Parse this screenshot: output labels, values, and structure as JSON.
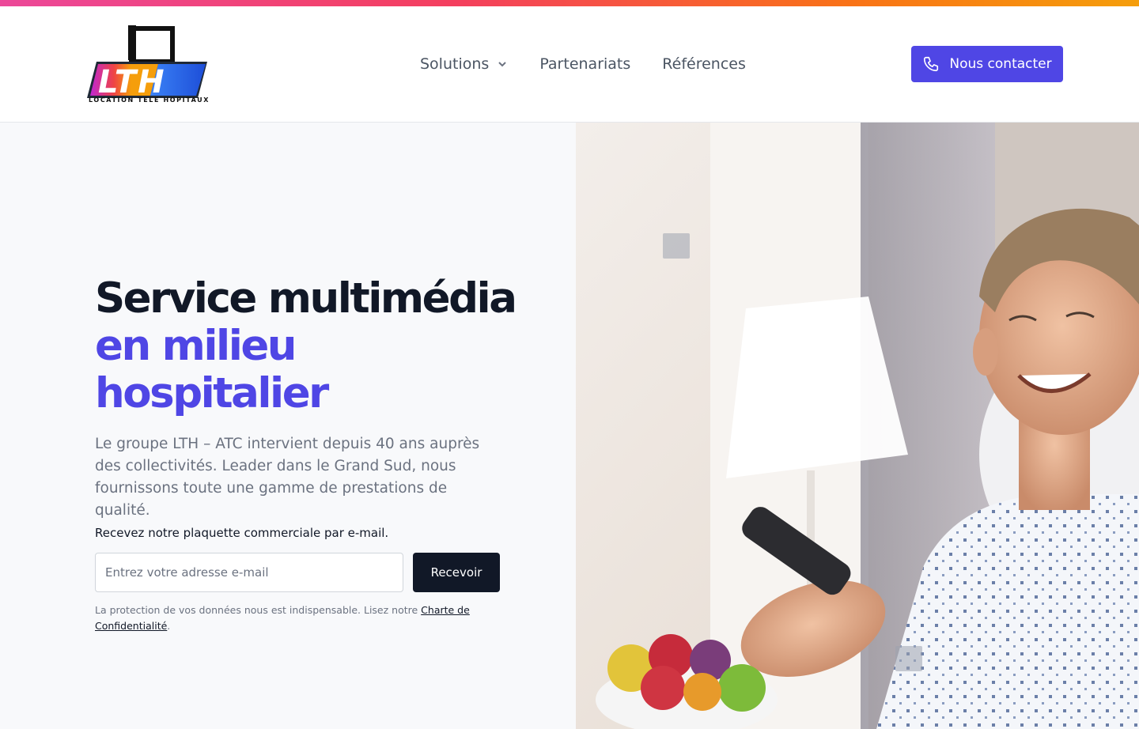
{
  "brand": {
    "logo_text": "LTH",
    "logo_tagline": "LOCATION TELE HOPITAUX",
    "colors": {
      "accent": "#4f46e5",
      "dark": "#111827",
      "gray": "#6b7280"
    }
  },
  "nav": {
    "items": [
      {
        "label": "Solutions",
        "has_dropdown": true
      },
      {
        "label": "Partenariats"
      },
      {
        "label": "Références"
      }
    ],
    "contact_label": "Nous contacter",
    "contact_icon": "phone-icon"
  },
  "hero": {
    "title_line1": "Service multimédia",
    "title_line2": "en milieu",
    "title_line3": "hospitalier",
    "description": "Le groupe LTH – ATC intervient depuis 40 ans auprès des collectivités. Leader dans le Grand Sud, nous fournissons toute une gamme de prestations de qualité.",
    "brochure_label": "Recevez notre plaquette commerciale par e-mail.",
    "email_placeholder": "Entrez votre adresse e-mail",
    "email_value": "",
    "submit_label": "Recevoir",
    "privacy_text": "La protection de vos données nous est indispensable. Lisez notre ",
    "privacy_link": "Charte de Confidentialité",
    "privacy_end": "."
  },
  "image": {
    "subject": "smiling patient in hospital gown holding a TV remote, fruit bowl and lamp in background"
  }
}
